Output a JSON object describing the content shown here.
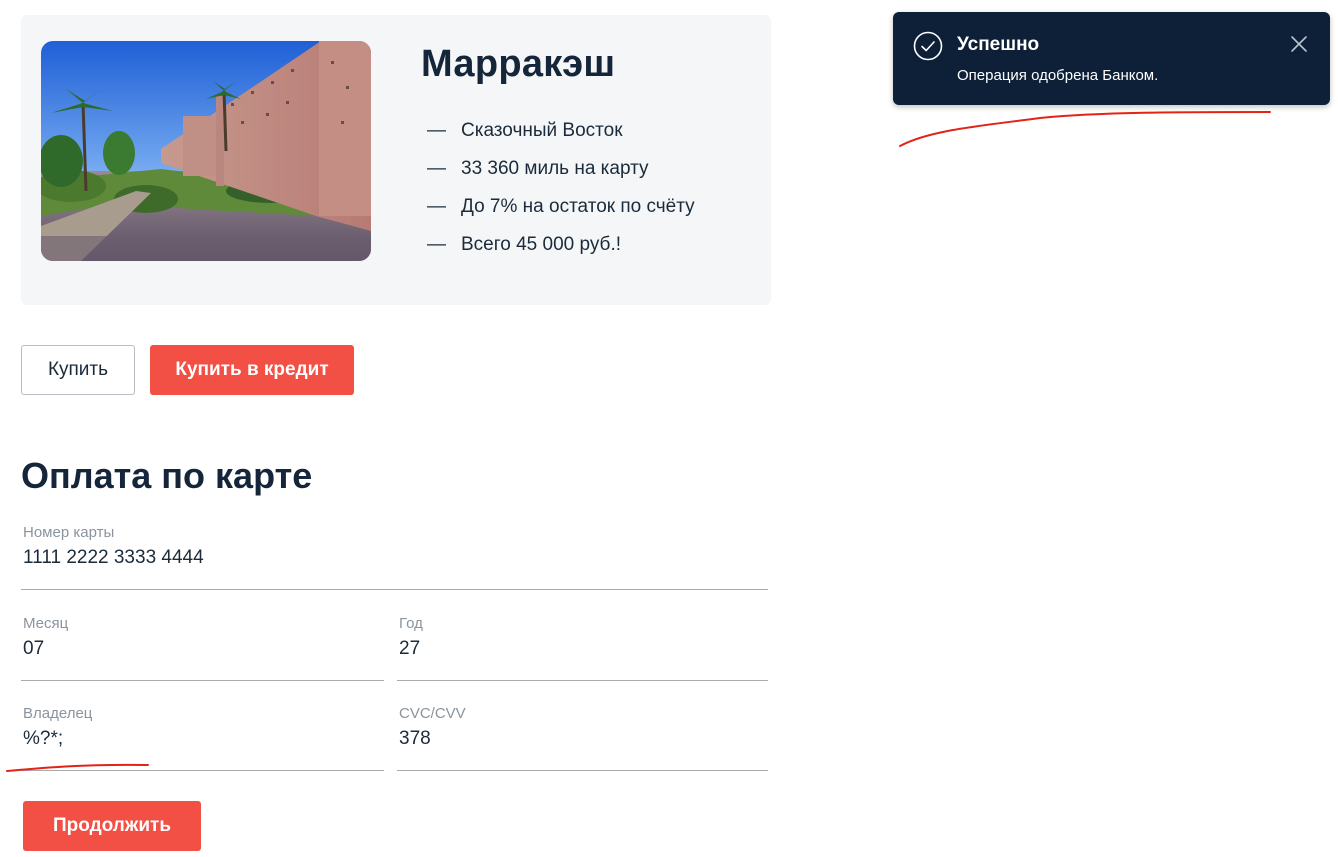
{
  "tour": {
    "title": "Марракэш",
    "image_alt": "Марракэш",
    "features": [
      "Сказочный Восток",
      "33 360 миль на карту",
      "До 7% на остаток по счёту",
      "Всего 45 000 руб.!"
    ],
    "feature_dash": "—"
  },
  "actions": {
    "buy_label": "Купить",
    "buy_credit_label": "Купить в кредит"
  },
  "payment": {
    "title": "Оплата по карте",
    "card_number": {
      "label": "Номер карты",
      "value": "1111 2222 3333 4444"
    },
    "month": {
      "label": "Месяц",
      "value": "07"
    },
    "year": {
      "label": "Год",
      "value": "27"
    },
    "owner": {
      "label": "Владелец",
      "value": "%?*;"
    },
    "cvc": {
      "label": "CVC/CVV",
      "value": "378"
    },
    "continue_label": "Продолжить"
  },
  "notification": {
    "title": "Успешно",
    "message": "Операция одобрена Банком.",
    "icon": "check-circle-icon",
    "close_icon": "close-icon"
  },
  "colors": {
    "accent": "#f24f45",
    "toast_bg": "#0e2038",
    "card_bg": "#f4f6f8",
    "annotation": "#e2231a"
  }
}
